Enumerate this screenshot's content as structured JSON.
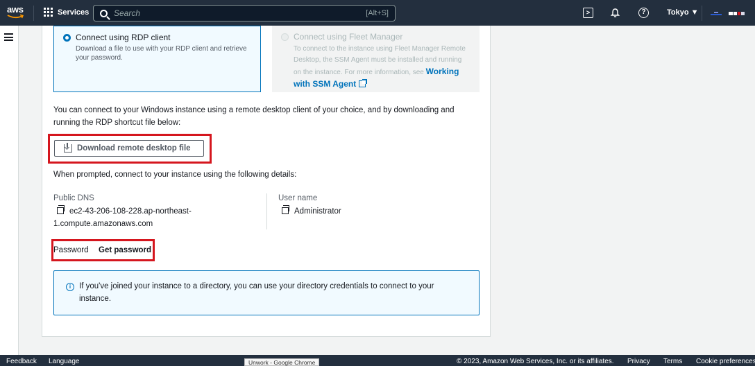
{
  "nav": {
    "logo": "aws",
    "services_label": "Services",
    "search_placeholder": "Search",
    "search_shortcut": "[Alt+S]",
    "region": "Tokyo ▼",
    "icons": [
      "cloudshell-icon",
      "bell-icon",
      "help-icon"
    ]
  },
  "tiles": {
    "rdp": {
      "title": "Connect using RDP client",
      "desc": "Download a file to use with your RDP client and retrieve your password."
    },
    "fleet": {
      "title": "Connect using Fleet Manager",
      "desc": "To connect to the instance using Fleet Manager Remote Desktop, the SSM Agent must be installed and running on the instance. For more information, see",
      "link": "Working with SSM Agent"
    }
  },
  "intro": "You can connect to your Windows instance using a remote desktop client of your choice, and by downloading and running the RDP shortcut file below:",
  "download_button": "Download remote desktop file",
  "prompt": "When prompted, connect to your instance using the following details:",
  "details": {
    "dns_label": "Public DNS",
    "dns_value": "ec2-43-206-108-228.ap-northeast-1.compute.amazonaws.com",
    "user_label": "User name",
    "user_value": "Administrator"
  },
  "password": {
    "label": "Password",
    "link": "Get password"
  },
  "info": "If you've joined your instance to a directory, you can use your directory credentials to connect to your instance.",
  "footer": {
    "feedback": "Feedback",
    "language": "Language",
    "copyright": "© 2023, Amazon Web Services, Inc. or its affiliates.",
    "privacy": "Privacy",
    "terms": "Terms",
    "cookies": "Cookie preferences"
  },
  "tooltip": "Unwork - Google Chrome",
  "colors": {
    "nav_bg": "#232f3e",
    "accent": "#0073bb",
    "highlight": "#d5161e"
  }
}
